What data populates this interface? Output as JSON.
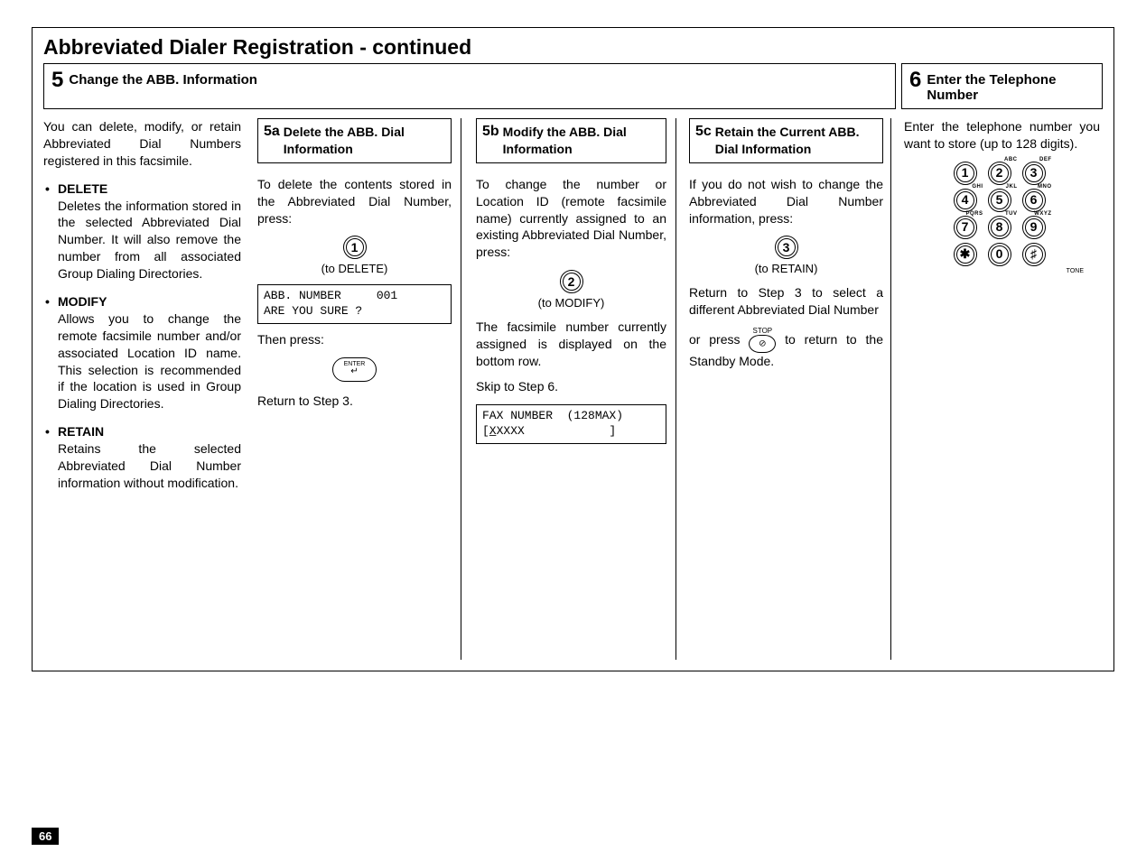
{
  "page_number": "66",
  "main_title": "Abbreviated Dialer Registration - continued",
  "step5": {
    "num": "5",
    "title": "Change the ABB. Information"
  },
  "step6": {
    "num": "6",
    "title": "Enter the Telephone Number"
  },
  "intro": "You can delete, modify, or retain Abbreviated Dial Numbers registered in this facsimile.",
  "bullets": {
    "delete": {
      "title": "DELETE",
      "text": "Deletes the information stored in the selected Abbreviated Dial Number. It will also remove the number from all associated Group Dialing Directories."
    },
    "modify": {
      "title": "MODIFY",
      "text": "Allows you to change the remote facsimile number and/or associated Location ID  name. This selection is recommended if the location is used in Group Dialing Directories."
    },
    "retain": {
      "title": "RETAIN",
      "text": "Retains the selected Abbreviated Dial Number information without modification."
    }
  },
  "s5a": {
    "num": "5a",
    "title": "Delete the ABB. Dial Information",
    "p1": "To delete the contents stored in the Abbreviated Dial Number, press:",
    "key": "1",
    "key_label": "(to DELETE)",
    "lcd": "ABB. NUMBER     001\nARE YOU SURE ?",
    "p2": "Then press:",
    "enter_label": "ENTER",
    "p3": "Return to Step 3."
  },
  "s5b": {
    "num": "5b",
    "title": "Modify the ABB. Dial Information",
    "p1": "To change the number or Location ID (remote facsimile name) currently assigned to an existing Abbreviated Dial Number, press:",
    "key": "2",
    "key_label": "(to MODIFY)",
    "p2": "The facsimile number currently assigned is displayed on the bottom row.",
    "p3": "Skip to Step 6.",
    "lcd": "FAX NUMBER  (128MAX)\n[X̲XXXX            ]"
  },
  "s5c": {
    "num": "5c",
    "title": "Retain the Current ABB. Dial Information",
    "p1": "If you do not wish to change the Abbreviated Dial Number information, press:",
    "key": "3",
    "key_label": "(to RETAIN)",
    "p2": "Return to Step 3 to select a different Abbreviated Dial Number",
    "stop_label": "STOP",
    "p3a": "or press ",
    "p3b": " to return to the Standby Mode."
  },
  "s6": {
    "p1": "Enter the telephone number you want to store (up to 128 digits).",
    "keypad": {
      "k1": "1",
      "k2": "2",
      "k3": "3",
      "k4": "4",
      "k5": "5",
      "k6": "6",
      "k7": "7",
      "k8": "8",
      "k9": "9",
      "kstar": "✱",
      "k0": "0",
      "khash": "♯",
      "l2": "ABC",
      "l3": "DEF",
      "l4": "GHI",
      "l5": "JKL",
      "l6": "MNO",
      "l7": "PQRS",
      "l8": "TUV",
      "l9": "WXYZ",
      "tone": "TONE"
    }
  }
}
